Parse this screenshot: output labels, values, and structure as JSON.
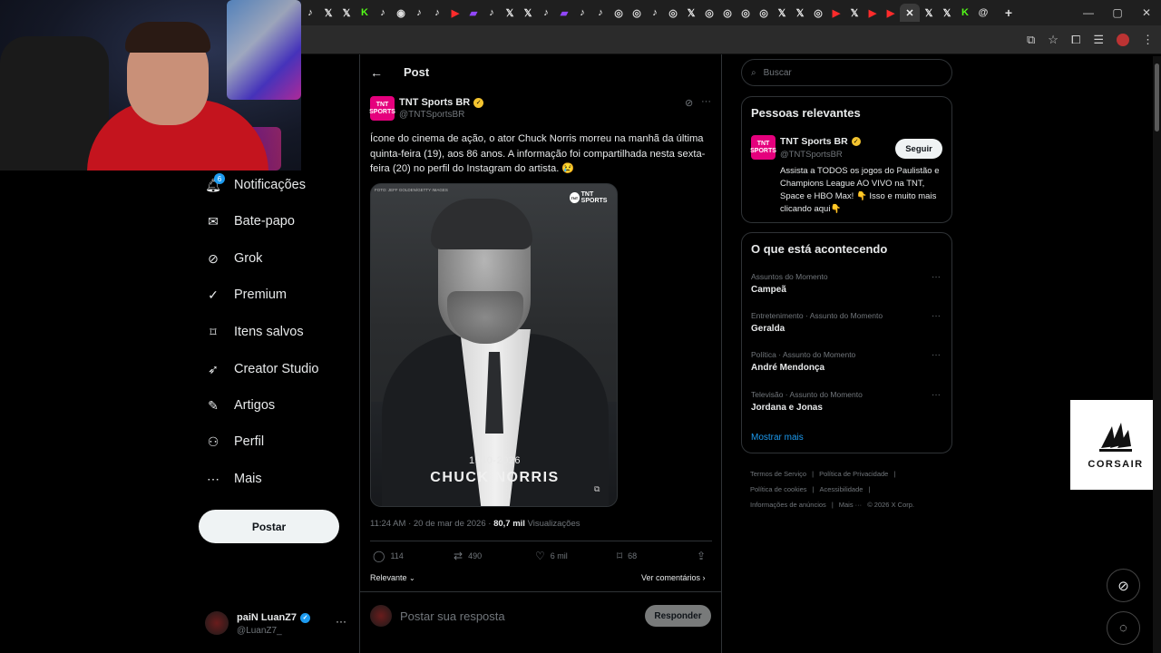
{
  "browser": {
    "tabs": [
      "tiktok",
      "x",
      "x",
      "kick",
      "tiktok",
      "chrome",
      "tiktok",
      "tiktok",
      "youtube",
      "twitch",
      "tiktok",
      "x",
      "x",
      "tiktok",
      "twitch",
      "tiktok",
      "tiktok",
      "instagram",
      "instagram",
      "tiktok",
      "instagram",
      "x",
      "instagram",
      "instagram",
      "instagram",
      "instagram",
      "x",
      "x",
      "instagram",
      "youtube",
      "x",
      "youtube",
      "youtube",
      "x",
      "x",
      "x",
      "kick",
      "threads"
    ],
    "active_tab_index": 33,
    "new_tab": "+",
    "window_controls": [
      "—",
      "▢",
      "✕"
    ]
  },
  "nav": {
    "items": [
      {
        "label": "Notificações",
        "icon": "bell-icon",
        "badge": "6"
      },
      {
        "label": "Bate-papo",
        "icon": "mail-icon"
      },
      {
        "label": "Grok",
        "icon": "grok-icon"
      },
      {
        "label": "Premium",
        "icon": "premium-icon"
      },
      {
        "label": "Itens salvos",
        "icon": "bookmark-icon"
      },
      {
        "label": "Creator Studio",
        "icon": "rocket-icon"
      },
      {
        "label": "Artigos",
        "icon": "article-icon"
      },
      {
        "label": "Perfil",
        "icon": "person-icon"
      },
      {
        "label": "Mais",
        "icon": "more-circle-icon"
      }
    ],
    "post_button": "Postar",
    "account": {
      "name": "paiN LuanZ7",
      "handle": "@LuanZ7_"
    }
  },
  "header": {
    "title": "Post"
  },
  "tweet": {
    "author_name": "TNT Sports BR",
    "author_handle": "@TNTSportsBR",
    "avatar_text": "TNT\nSPORTS",
    "text": "Ícone do cinema de ação, o ator Chuck Norris morreu na manhã da última quinta-feira (19), aos 86 anos. A informação foi compartilhada nesta sexta-feira (20) no perfil do Instagram do artista. 😢",
    "image": {
      "credit": "FOTO: JEFF GOLDEN/GETTY IMAGES",
      "brand": "TNT SPORTS",
      "years": "1940-2026",
      "name": "CHUCK NORRIS"
    },
    "timestamp": "11:24 AM · 20 de mar de 2026 · ",
    "views_count": "80,7 mil",
    "views_label": " Visualizações",
    "replies": "114",
    "retweets": "490",
    "likes": "6 mil",
    "bookmarks": "68",
    "sort_label": "Relevante",
    "view_comments": "Ver comentários",
    "reply_placeholder": "Postar sua resposta",
    "reply_button": "Responder"
  },
  "search": {
    "placeholder": "Buscar"
  },
  "relevant": {
    "title": "Pessoas relevantes",
    "name": "TNT Sports BR",
    "handle": "@TNTSportsBR",
    "follow": "Seguir",
    "bio": "Assista a TODOS os jogos do Paulistão e Champions League AO VIVO na TNT, Space e HBO Max! 👇 Isso e muito mais clicando aqui👇"
  },
  "trends": {
    "title": "O que está acontecendo",
    "items": [
      {
        "category": "Assuntos do Momento",
        "name": "Campeã"
      },
      {
        "category": "Entretenimento · Assunto do Momento",
        "name": "Geralda"
      },
      {
        "category": "Política · Assunto do Momento",
        "name": "André Mendonça"
      },
      {
        "category": "Televisão · Assunto do Momento",
        "name": "Jordana e Jonas"
      }
    ],
    "show_more": "Mostrar mais"
  },
  "footer": {
    "links": [
      "Termos de Serviço",
      "|",
      "Política de Privacidade",
      "|",
      "Política de cookies",
      "|",
      "Acessibilidade",
      "|",
      "Informações de anúncios",
      "|",
      "Mais ···",
      "© 2026 X Corp."
    ]
  },
  "overlay": {
    "corsair": "CORSAIR"
  },
  "colors": {
    "accent": "#1d9bf0",
    "brand_pink": "#e5007d",
    "verified": "#f4c430"
  }
}
